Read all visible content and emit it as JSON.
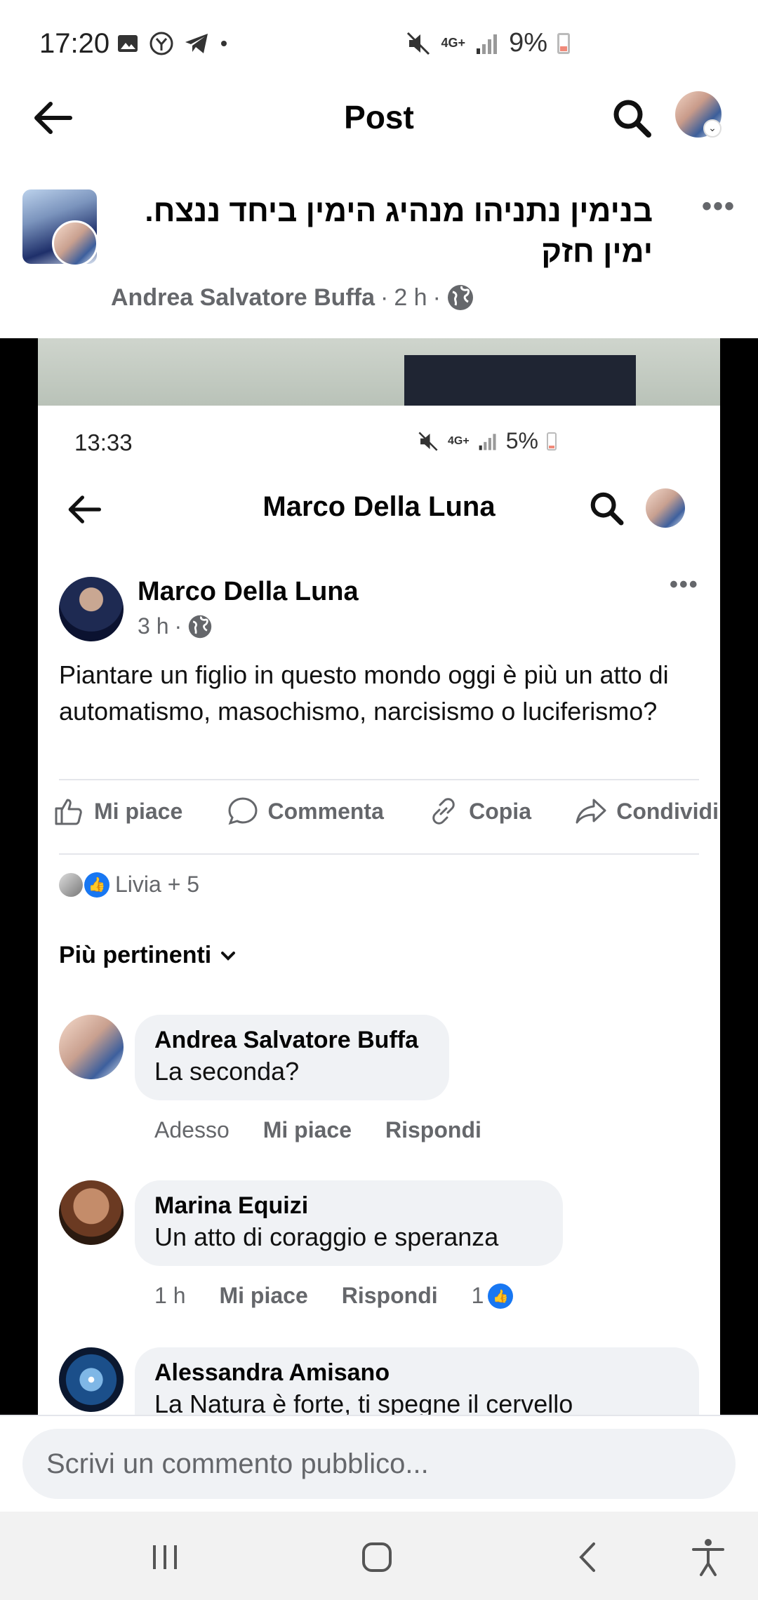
{
  "status_bar": {
    "time": "17:20",
    "network": "4G+",
    "battery": "9%"
  },
  "appbar": {
    "title": "Post"
  },
  "post": {
    "text_line1": "בנימין  נתניהו מנהיג הימין  ביחד ננצח.",
    "text_line2": "ימין  חזק",
    "author": "Andrea Salvatore Buffa",
    "time": "2 h"
  },
  "shared": {
    "status_bar": {
      "time": "13:33",
      "network": "4G+",
      "battery": "5%"
    },
    "header_title": "Marco Della Luna",
    "author": "Marco Della Luna",
    "time": "3 h",
    "body": "Piantare un figlio in questo mondo oggi è più un atto di automatismo, masochismo, narcisismo o luciferismo?",
    "actions": {
      "like": "Mi piace",
      "comment": "Commenta",
      "copy": "Copia",
      "share": "Condividi"
    },
    "reactions": "Livia + 5",
    "sort": "Più pertinenti",
    "comments": [
      {
        "name": "Andrea Salvatore Buffa",
        "text": "La seconda?",
        "time": "Adesso",
        "like": "Mi piace",
        "reply": "Rispondi"
      },
      {
        "name": "Marina Equizi",
        "text": "Un atto di coraggio e speranza",
        "time": "1 h",
        "like": "Mi piace",
        "reply": "Rispondi",
        "likes": "1"
      },
      {
        "name": "Alessandra Amisano",
        "text": "La Natura è forte, ti spegne il cervello"
      }
    ]
  },
  "composer": {
    "placeholder": "Scrivi un commento pubblico..."
  },
  "colors": {
    "accent": "#1877f2",
    "muted": "#65676b",
    "bubble": "#f0f2f5"
  }
}
